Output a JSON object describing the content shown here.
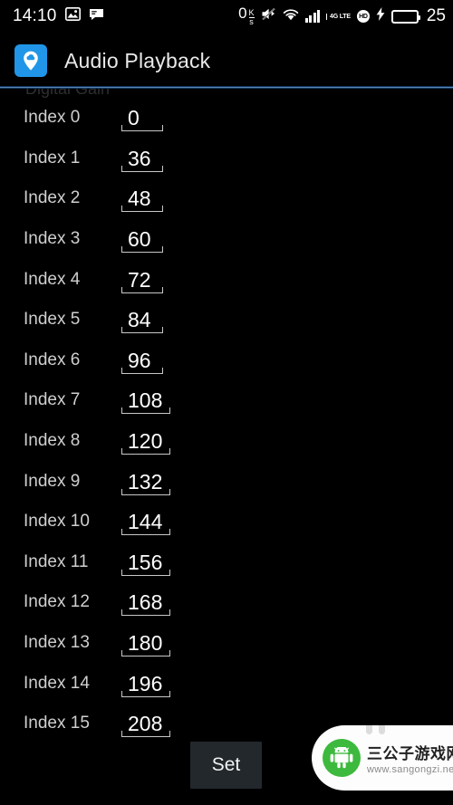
{
  "status_bar": {
    "clock": "14:10",
    "left_icons": [
      "photo-icon",
      "message-icon"
    ],
    "net_speed_value": "0",
    "net_speed_num": "K",
    "net_speed_den": "s",
    "right_icons": [
      "mute-icon",
      "wifi-icon",
      "signal-bars-icon",
      "4g-lte-icon",
      "hd-icon",
      "charging-bolt-icon",
      "battery-icon"
    ],
    "lte_top": "4G",
    "lte_bottom": "LTE",
    "hd_label": "HD",
    "battery_percent": "25"
  },
  "action_bar": {
    "app_icon": "location-cloud-icon",
    "title": "Audio Playback"
  },
  "content": {
    "section_title": "Digital Gain",
    "rows": [
      {
        "label": "Index 0",
        "value": "0"
      },
      {
        "label": "Index 1",
        "value": "36"
      },
      {
        "label": "Index 2",
        "value": "48"
      },
      {
        "label": "Index 3",
        "value": "60"
      },
      {
        "label": "Index 4",
        "value": "72"
      },
      {
        "label": "Index 5",
        "value": "84"
      },
      {
        "label": "Index 6",
        "value": "96"
      },
      {
        "label": "Index 7",
        "value": "108"
      },
      {
        "label": "Index 8",
        "value": "120"
      },
      {
        "label": "Index 9",
        "value": "132"
      },
      {
        "label": "Index 10",
        "value": "144"
      },
      {
        "label": "Index 11",
        "value": "156"
      },
      {
        "label": "Index 12",
        "value": "168"
      },
      {
        "label": "Index 13",
        "value": "180"
      },
      {
        "label": "Index 14",
        "value": "196"
      },
      {
        "label": "Index 15",
        "value": "208"
      }
    ],
    "set_button_label": "Set"
  },
  "watermark": {
    "logo": "android-robot-icon",
    "title": "三公子游戏网",
    "url": "www.sangongzi.net"
  },
  "colors": {
    "background": "#000000",
    "accent_blue": "#2196e8",
    "divider_blue": "#5b86b3",
    "label_gray": "#cfcfcf",
    "value_white": "#ffffff",
    "button_gray": "#23282d",
    "battery_green": "#2bd52b",
    "watermark_green": "#3db93d"
  }
}
